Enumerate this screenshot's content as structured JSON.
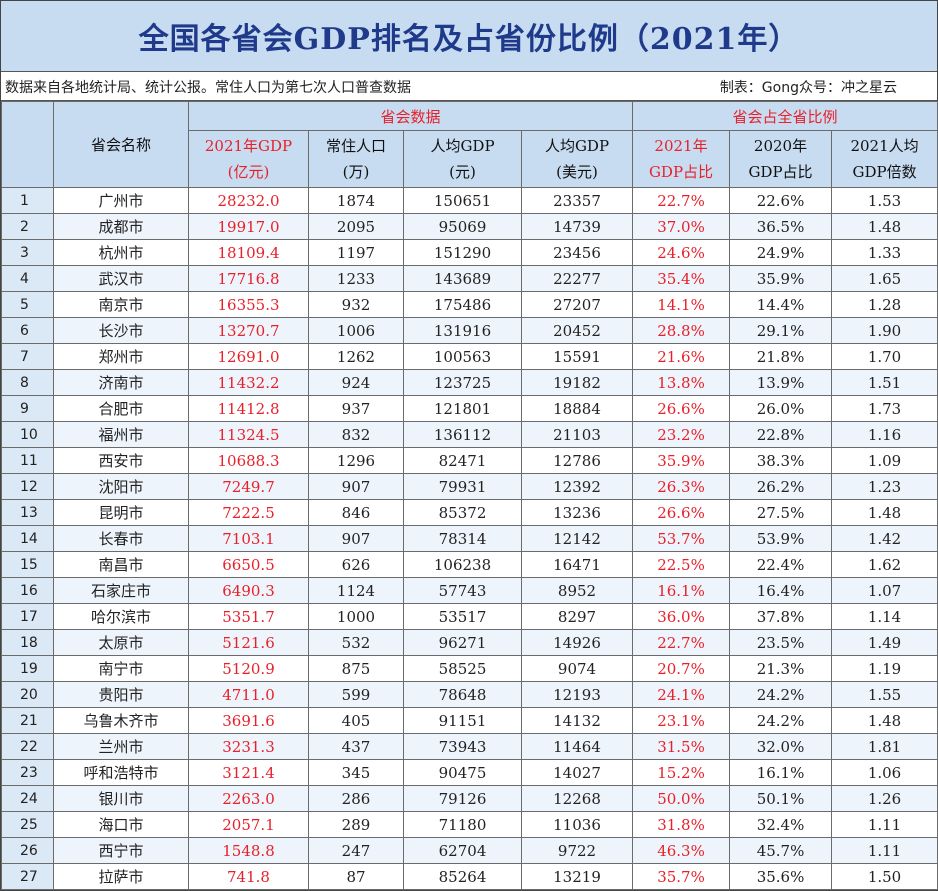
{
  "title": "全国各省会GDP排名及占省份比例（2021年）",
  "source_note": "数据来自各地统计局、统计公报。常住人口为第七次人口普查数据",
  "author_note": "制表：Gong众号：冲之星云",
  "headers": {
    "name": "省会名称",
    "group_data": "省会数据",
    "group_ratio": "省会占全省比例",
    "gdp_2021": [
      "2021年GDP",
      "(亿元)"
    ],
    "population": [
      "常住人口",
      "(万)"
    ],
    "per_capita_yuan": [
      "人均GDP",
      "(元)"
    ],
    "per_capita_usd": [
      "人均GDP",
      "(美元)"
    ],
    "share_2021": [
      "2021年",
      "GDP占比"
    ],
    "share_2020": [
      "2020年",
      "GDP占比"
    ],
    "multiple_2021": [
      "2021人均",
      "GDP倍数"
    ]
  },
  "rows": [
    [
      "1",
      "广州市",
      "28232.0",
      "1874",
      "150651",
      "23357",
      "22.7%",
      "22.6%",
      "1.53"
    ],
    [
      "2",
      "成都市",
      "19917.0",
      "2095",
      "95069",
      "14739",
      "37.0%",
      "36.5%",
      "1.48"
    ],
    [
      "3",
      "杭州市",
      "18109.4",
      "1197",
      "151290",
      "23456",
      "24.6%",
      "24.9%",
      "1.33"
    ],
    [
      "4",
      "武汉市",
      "17716.8",
      "1233",
      "143689",
      "22277",
      "35.4%",
      "35.9%",
      "1.65"
    ],
    [
      "5",
      "南京市",
      "16355.3",
      "932",
      "175486",
      "27207",
      "14.1%",
      "14.4%",
      "1.28"
    ],
    [
      "6",
      "长沙市",
      "13270.7",
      "1006",
      "131916",
      "20452",
      "28.8%",
      "29.1%",
      "1.90"
    ],
    [
      "7",
      "郑州市",
      "12691.0",
      "1262",
      "100563",
      "15591",
      "21.6%",
      "21.8%",
      "1.70"
    ],
    [
      "8",
      "济南市",
      "11432.2",
      "924",
      "123725",
      "19182",
      "13.8%",
      "13.9%",
      "1.51"
    ],
    [
      "9",
      "合肥市",
      "11412.8",
      "937",
      "121801",
      "18884",
      "26.6%",
      "26.0%",
      "1.73"
    ],
    [
      "10",
      "福州市",
      "11324.5",
      "832",
      "136112",
      "21103",
      "23.2%",
      "22.8%",
      "1.16"
    ],
    [
      "11",
      "西安市",
      "10688.3",
      "1296",
      "82471",
      "12786",
      "35.9%",
      "38.3%",
      "1.09"
    ],
    [
      "12",
      "沈阳市",
      "7249.7",
      "907",
      "79931",
      "12392",
      "26.3%",
      "26.2%",
      "1.23"
    ],
    [
      "13",
      "昆明市",
      "7222.5",
      "846",
      "85372",
      "13236",
      "26.6%",
      "27.5%",
      "1.48"
    ],
    [
      "14",
      "长春市",
      "7103.1",
      "907",
      "78314",
      "12142",
      "53.7%",
      "53.9%",
      "1.42"
    ],
    [
      "15",
      "南昌市",
      "6650.5",
      "626",
      "106238",
      "16471",
      "22.5%",
      "22.4%",
      "1.62"
    ],
    [
      "16",
      "石家庄市",
      "6490.3",
      "1124",
      "57743",
      "8952",
      "16.1%",
      "16.4%",
      "1.07"
    ],
    [
      "17",
      "哈尔滨市",
      "5351.7",
      "1000",
      "53517",
      "8297",
      "36.0%",
      "37.8%",
      "1.14"
    ],
    [
      "18",
      "太原市",
      "5121.6",
      "532",
      "96271",
      "14926",
      "22.7%",
      "23.5%",
      "1.49"
    ],
    [
      "19",
      "南宁市",
      "5120.9",
      "875",
      "58525",
      "9074",
      "20.7%",
      "21.3%",
      "1.19"
    ],
    [
      "20",
      "贵阳市",
      "4711.0",
      "599",
      "78648",
      "12193",
      "24.1%",
      "24.2%",
      "1.55"
    ],
    [
      "21",
      "乌鲁木齐市",
      "3691.6",
      "405",
      "91151",
      "14132",
      "23.1%",
      "24.2%",
      "1.48"
    ],
    [
      "22",
      "兰州市",
      "3231.3",
      "437",
      "73943",
      "11464",
      "31.5%",
      "32.0%",
      "1.81"
    ],
    [
      "23",
      "呼和浩特市",
      "3121.4",
      "345",
      "90475",
      "14027",
      "15.2%",
      "16.1%",
      "1.06"
    ],
    [
      "24",
      "银川市",
      "2263.0",
      "286",
      "79126",
      "12268",
      "50.0%",
      "50.1%",
      "1.26"
    ],
    [
      "25",
      "海口市",
      "2057.1",
      "289",
      "71180",
      "11036",
      "31.8%",
      "32.4%",
      "1.11"
    ],
    [
      "26",
      "西宁市",
      "1548.8",
      "247",
      "62704",
      "9722",
      "46.3%",
      "45.7%",
      "1.11"
    ],
    [
      "27",
      "拉萨市",
      "741.8",
      "87",
      "85264",
      "13219",
      "35.7%",
      "35.6%",
      "1.50"
    ]
  ]
}
